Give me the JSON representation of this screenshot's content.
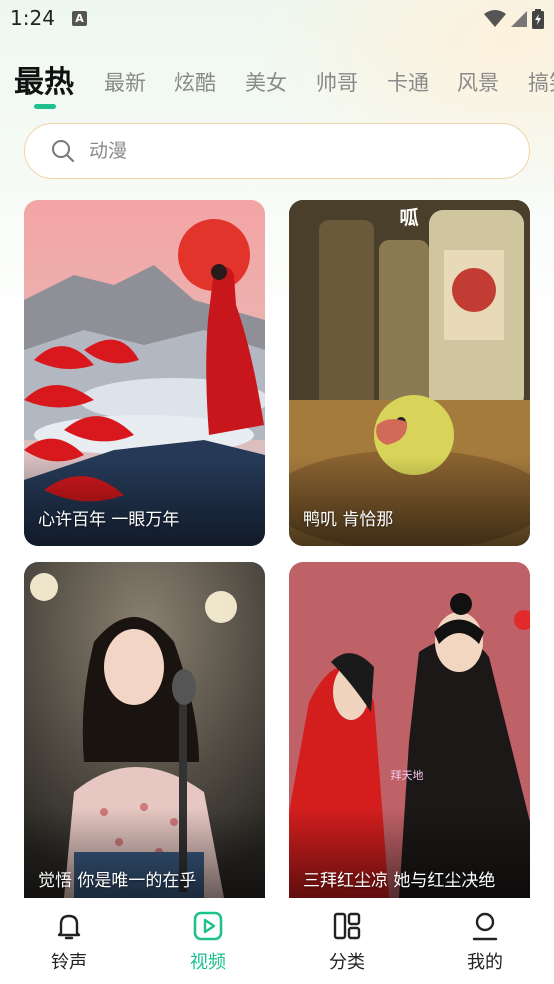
{
  "status_bar": {
    "time": "1:24",
    "notification_glyph": "A"
  },
  "tabs": [
    {
      "label": "最热",
      "active": true
    },
    {
      "label": "最新",
      "active": false
    },
    {
      "label": "炫酷",
      "active": false
    },
    {
      "label": "美女",
      "active": false
    },
    {
      "label": "帅哥",
      "active": false
    },
    {
      "label": "卡通",
      "active": false
    },
    {
      "label": "风景",
      "active": false
    },
    {
      "label": "搞笑",
      "active": false
    }
  ],
  "search": {
    "placeholder": "动漫"
  },
  "cards": [
    {
      "title": "心许百年 一眼万年"
    },
    {
      "title": "鸭叽 肯恰那",
      "overlay_text": "呱"
    },
    {
      "title": "觉悟 你是唯一的在乎"
    },
    {
      "title": "三拜红尘凉 她与红尘决绝",
      "overlay_text": "拜天地"
    }
  ],
  "bottom_nav": [
    {
      "label": "铃声",
      "icon": "bell-icon",
      "active": false
    },
    {
      "label": "视频",
      "icon": "play-icon",
      "active": true
    },
    {
      "label": "分类",
      "icon": "category-icon",
      "active": false
    },
    {
      "label": "我的",
      "icon": "user-icon",
      "active": false
    }
  ],
  "colors": {
    "accent": "#1ec08e",
    "search_border": "#f2d2a8"
  }
}
